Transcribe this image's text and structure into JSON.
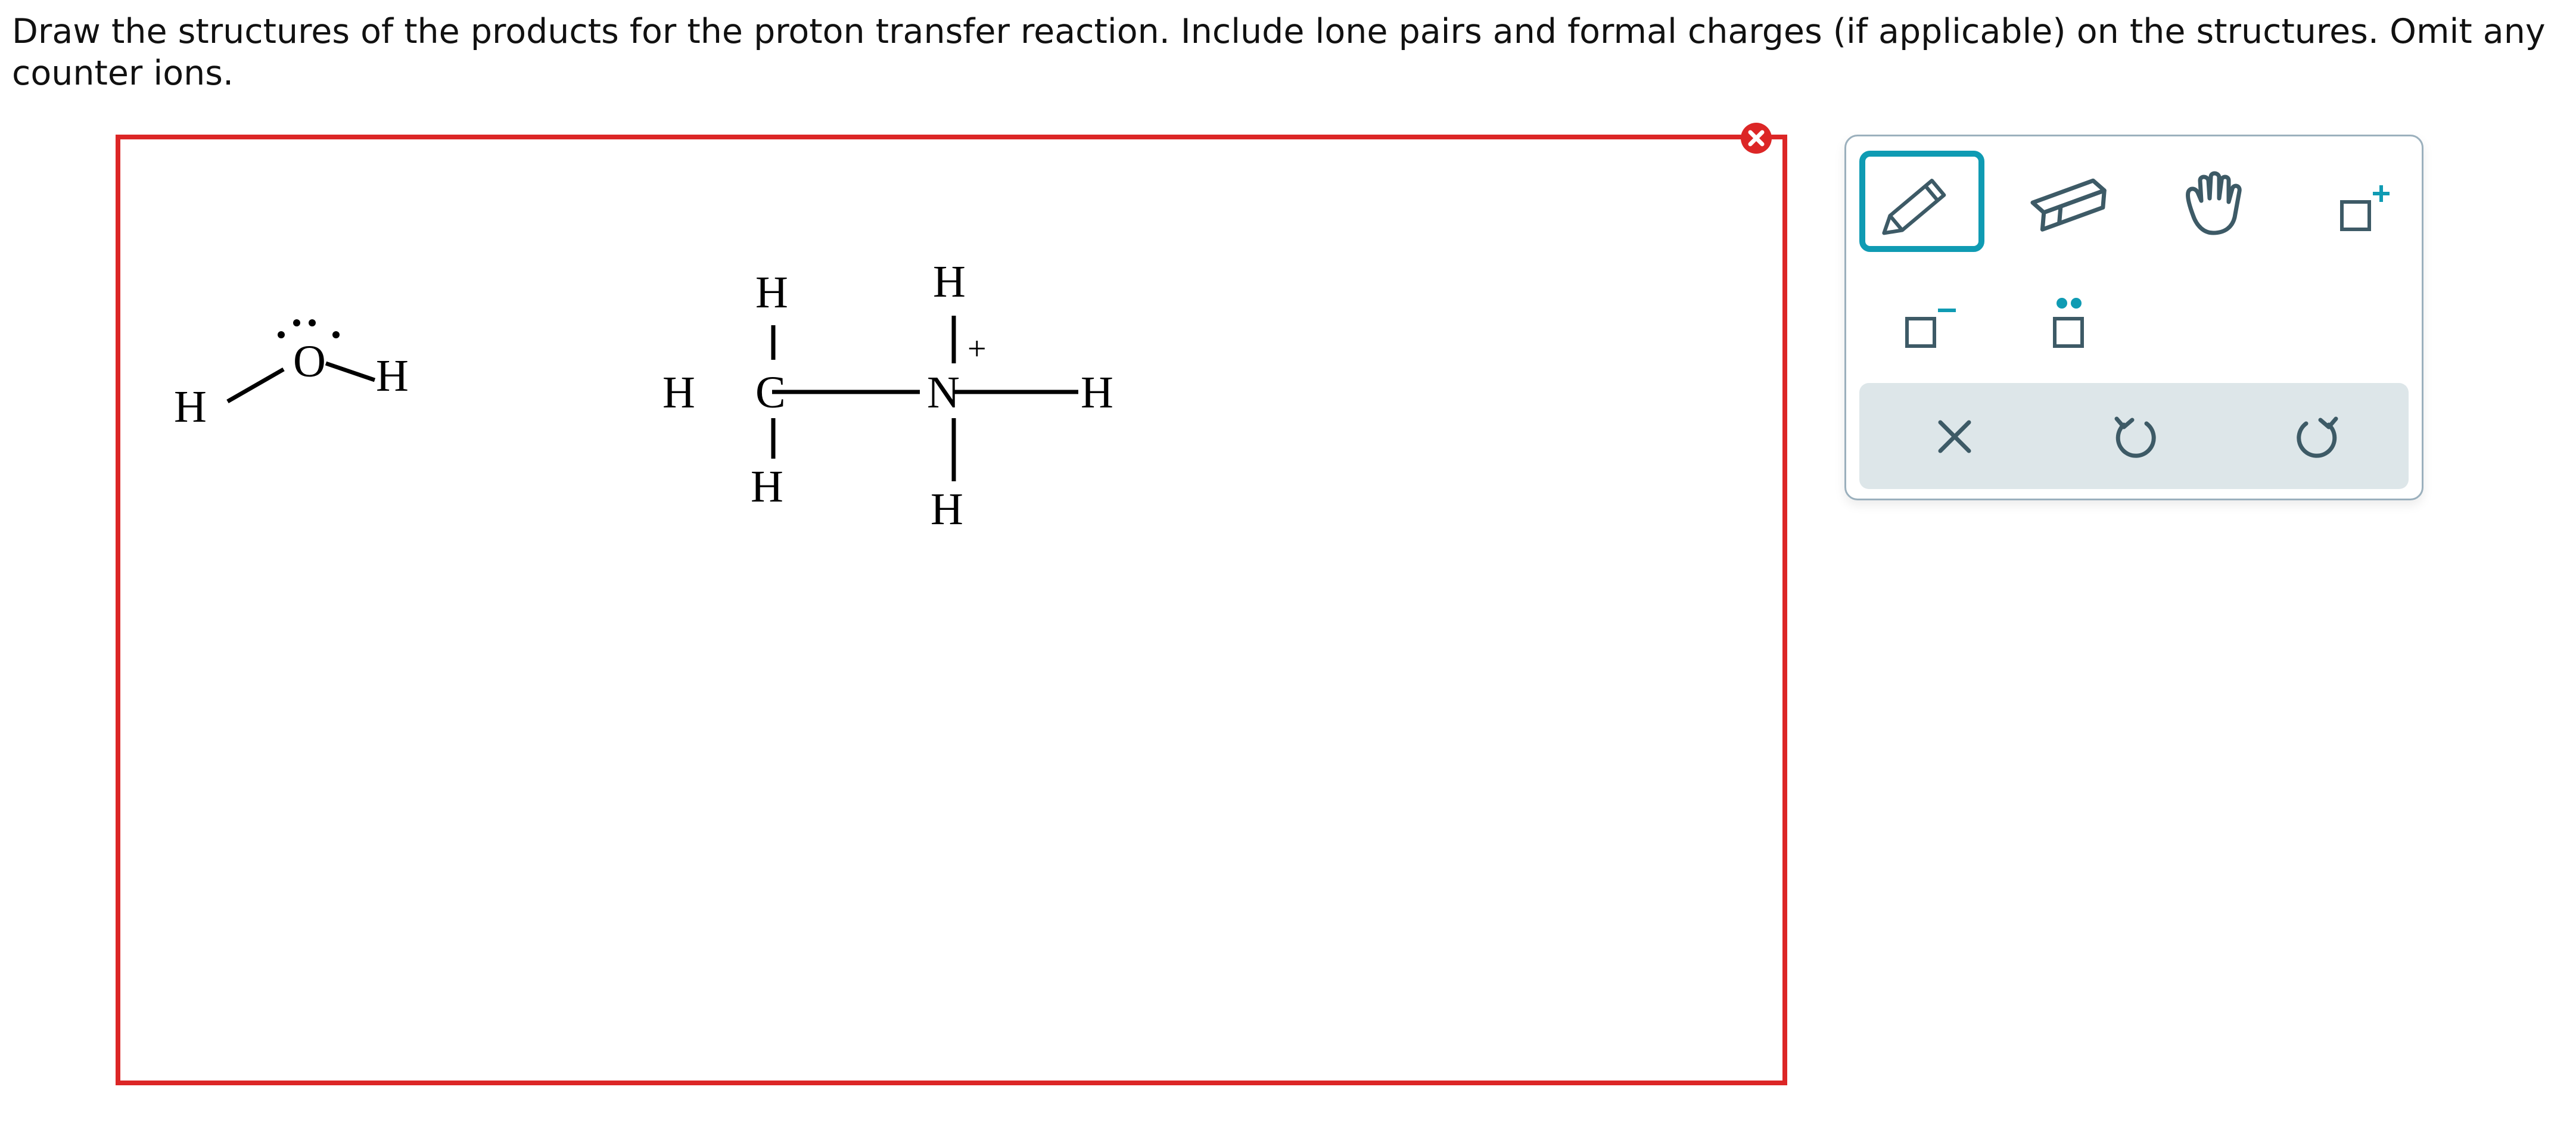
{
  "prompt": {
    "text": "Draw the structures of the products for the proton transfer reaction. Include lone pairs and formal charges (if applicable) on the structures. Omit any counter ions."
  },
  "molecules": {
    "water": {
      "o": "O",
      "h_left": "H",
      "h_right": "H"
    },
    "methylammonium": {
      "c": "C",
      "n": "N",
      "h_c_top": "H",
      "h_c_left": "H",
      "h_c_bottom": "H",
      "h_n_top": "H",
      "h_n_right": "H",
      "h_n_bottom": "H",
      "charge": "+"
    }
  },
  "toolbar": {
    "tools": [
      "pencil-icon",
      "eraser-icon",
      "hand-icon",
      "positive-charge-icon",
      "negative-charge-icon",
      "lone-pair-icon"
    ],
    "actions": [
      "clear-icon",
      "undo-icon",
      "redo-icon"
    ],
    "selected_tool": "pencil-icon"
  },
  "colors": {
    "error": "#dc2626",
    "accent": "#0f9bb3",
    "icon": "#3d5a66",
    "action_bar": "#dde6e9"
  }
}
